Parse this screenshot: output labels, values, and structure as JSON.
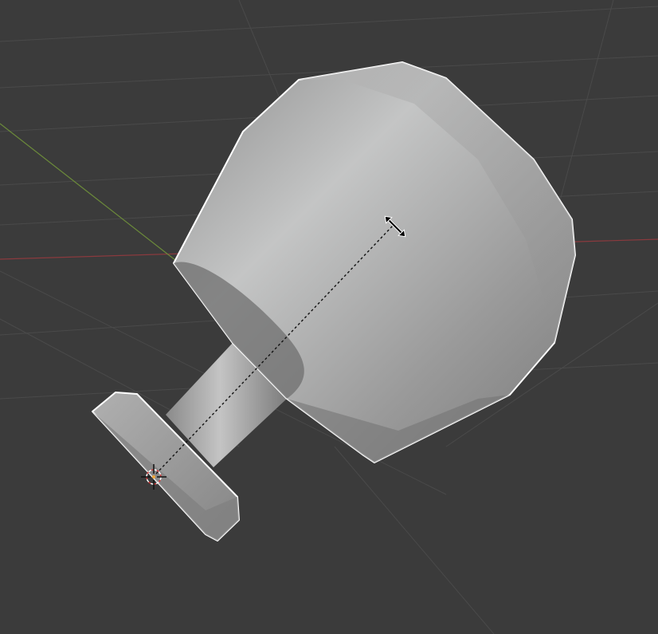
{
  "viewport": {
    "background": "#3b3b3b",
    "grid_color": "#4a4a4a",
    "x_axis_color": "#8a3a3e",
    "y_axis_color": "#6b8a3a",
    "outline_color": "#ffffff",
    "object_color": "#9a9a9a"
  },
  "tool": {
    "mode": "scale",
    "cursor_icon": "resize-arrows-icon",
    "pivot_icon": "3d-cursor-icon"
  }
}
